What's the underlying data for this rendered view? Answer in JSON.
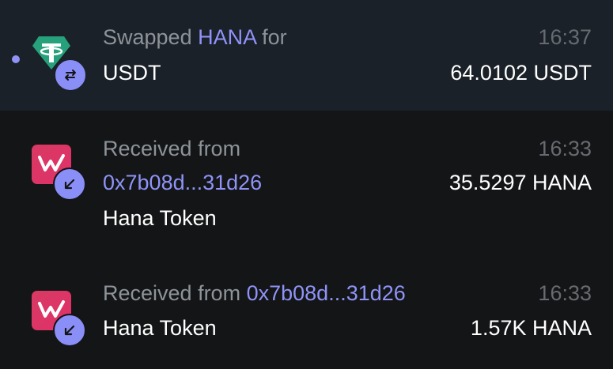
{
  "colors": {
    "accent": "#8f93f8",
    "badge": "#8a8ef7",
    "tether": "#26a17b",
    "hana": "#e0306a"
  },
  "transactions": [
    {
      "type": "swap",
      "unread": true,
      "icon": "tether-icon",
      "badge_icon": "swap-arrows-icon",
      "prefix": "Swapped",
      "token_symbol": "HANA",
      "suffix": "for",
      "time": "16:37",
      "target_token": "USDT",
      "amount": "64.0102 USDT"
    },
    {
      "type": "receive",
      "icon": "hana-token-icon",
      "badge_icon": "arrow-down-left-icon",
      "label": "Received from",
      "address": "0x7b08d...31d26",
      "time": "16:33",
      "token_name": "Hana Token",
      "amount": "35.5297 HANA"
    },
    {
      "type": "receive",
      "icon": "hana-token-icon",
      "badge_icon": "arrow-down-left-icon",
      "label": "Received from",
      "address": "0x7b08d...31d26",
      "time": "16:33",
      "token_name": "Hana Token",
      "amount": "1.57K HANA"
    }
  ]
}
